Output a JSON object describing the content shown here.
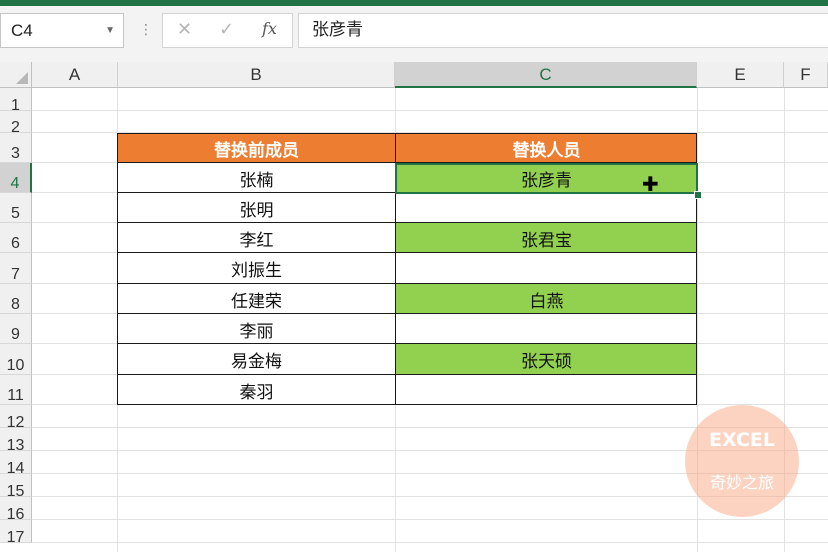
{
  "formula_bar": {
    "name_box": "C4",
    "name_box_dropdown": "▼",
    "separator": "⋮",
    "cancel": "✕",
    "enter": "✓",
    "fx": "fx",
    "content": "张彦青"
  },
  "columns": [
    "A",
    "B",
    "C",
    "E",
    "F"
  ],
  "rows": [
    "1",
    "2",
    "3",
    "4",
    "5",
    "6",
    "7",
    "8",
    "9",
    "10",
    "11",
    "12",
    "13",
    "14",
    "15",
    "16",
    "17"
  ],
  "selected_cell": {
    "column": "C",
    "row": "4"
  },
  "table": {
    "header": [
      "替换前成员",
      "替换人员"
    ],
    "rows": [
      {
        "b": "张楠",
        "c": "张彦青",
        "green": true
      },
      {
        "b": "张明",
        "c": "",
        "green": false
      },
      {
        "b": "李红",
        "c": "张君宝",
        "green": true
      },
      {
        "b": "刘振生",
        "c": "",
        "green": false
      },
      {
        "b": "任建荣",
        "c": "白燕",
        "green": true
      },
      {
        "b": "李丽",
        "c": "",
        "green": false
      },
      {
        "b": "易金梅",
        "c": "张天硕",
        "green": true
      },
      {
        "b": "秦羽",
        "c": "",
        "green": false
      }
    ]
  },
  "colors": {
    "header_fill": "#ed7d31",
    "highlight_fill": "#92d050",
    "excel_green": "#217346"
  },
  "watermark": {
    "line1": "EXCEL",
    "line2": "奇妙之旅"
  }
}
